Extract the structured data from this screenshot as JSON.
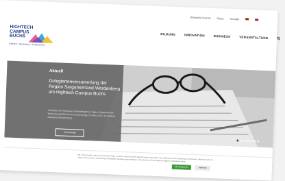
{
  "header": {
    "top_links": [
      "Übersicht Events",
      "News",
      "Kontakt"
    ],
    "lang_flags": [
      "flag-de-icon",
      "flag-en-icon"
    ],
    "logo": {
      "line1": "HIGHTECH",
      "line2": "CAMPUS",
      "line3": "BUCHS",
      "tagline": "Rheintal · Werdenberg · Sarganserland"
    },
    "nav": [
      "BILDUNG",
      "INNOVATION",
      "BUSINESS",
      "VERANSTALTUNG"
    ]
  },
  "hero": {
    "label": "Aktuell",
    "title": "Delegiertenversammlung der Region Sarganserland-Werdenberg am Hightech Campus Buchs",
    "text": "Anlässlich der Freitag des Jahresdelegierten Region Sarganserland-Werdenberg (RSW) fand am Donnerstag, 28. März 2024, die jährliche Delegiertenversammlung.",
    "button": "Zum Beitrag",
    "slides": 7,
    "active_slide": 0
  },
  "cookie": {
    "text": "Wir nutzen Cookies auf unserer Website. Einige von ihnen sind essenziell, während andere uns helfen, diese Website und Ihre Erfahrung zu verbessern. Wenn Sie unter 16 Jahre alt sind und Ihre Zustimmung zu freiwilligen Diensten geben möchten, müssen Sie Ihre Erziehungsberechtigten um Erlaubnis bitten.",
    "accept": "Alle akzeptieren",
    "decline": "Ablehnen"
  },
  "colors": {
    "brand": "#1f3d8a",
    "accept": "#3d9b3a"
  }
}
